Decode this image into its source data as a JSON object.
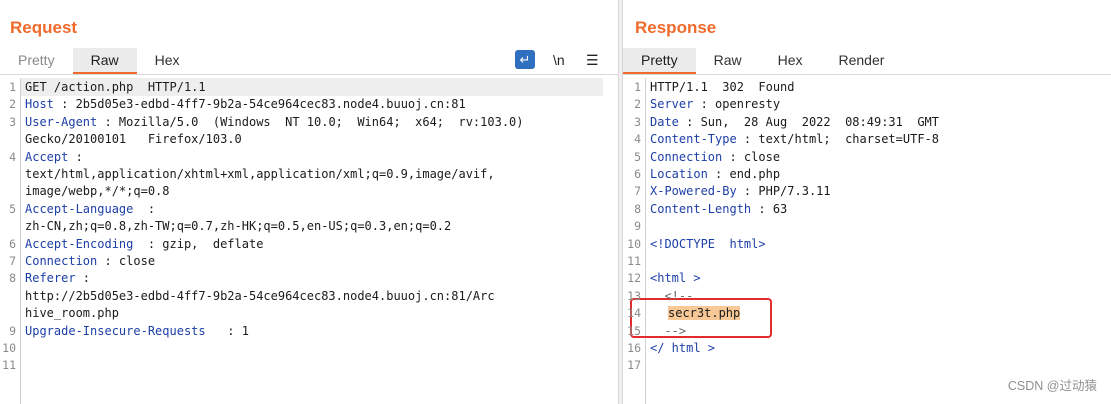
{
  "request": {
    "title": "Request",
    "tabs": [
      "Pretty",
      "Raw",
      "Hex"
    ],
    "tools": {
      "wrap_icon": "↵",
      "newline_toggle": "\\n",
      "menu": "☰"
    },
    "lines": [
      {
        "n": "1",
        "key": "",
        "text": "GET /action.php  HTTP/1.1"
      },
      {
        "n": "2",
        "key": "Host",
        "text": " : 2b5d05e3-edbd-4ff7-9b2a-54ce964cec83.node4.buuoj.cn:81"
      },
      {
        "n": "3",
        "key": "User-Agent",
        "text": " : Mozilla/5.0  (Windows  NT 10.0;  Win64;  x64;  rv:103.0)"
      },
      {
        "n": "",
        "key": "",
        "text": "Gecko/20100101   Firefox/103.0"
      },
      {
        "n": "4",
        "key": "Accept",
        "text": " :"
      },
      {
        "n": "",
        "key": "",
        "text": "text/html,application/xhtml+xml,application/xml;q=0.9,image/avif,"
      },
      {
        "n": "",
        "key": "",
        "text": "image/webp,*/*;q=0.8"
      },
      {
        "n": "5",
        "key": "Accept-Language",
        "text": "  :"
      },
      {
        "n": "",
        "key": "",
        "text": "zh-CN,zh;q=0.8,zh-TW;q=0.7,zh-HK;q=0.5,en-US;q=0.3,en;q=0.2"
      },
      {
        "n": "6",
        "key": "Accept-Encoding",
        "text": "  : gzip,  deflate"
      },
      {
        "n": "7",
        "key": "Connection",
        "text": " : close"
      },
      {
        "n": "8",
        "key": "Referer",
        "text": " :"
      },
      {
        "n": "",
        "key": "",
        "text": "http://2b5d05e3-edbd-4ff7-9b2a-54ce964cec83.node4.buuoj.cn:81/Arc"
      },
      {
        "n": "",
        "key": "",
        "text": "hive_room.php"
      },
      {
        "n": "9",
        "key": "Upgrade-Insecure-Requests",
        "text": "   : 1"
      },
      {
        "n": "10",
        "key": "",
        "text": ""
      },
      {
        "n": "11",
        "key": "",
        "text": ""
      }
    ]
  },
  "response": {
    "title": "Response",
    "tabs": [
      "Pretty",
      "Raw",
      "Hex",
      "Render"
    ],
    "lines": [
      {
        "n": "1",
        "key": "",
        "text": "HTTP/1.1  302  Found"
      },
      {
        "n": "2",
        "key": "Server",
        "text": " : openresty"
      },
      {
        "n": "3",
        "key": "Date",
        "text": " : Sun,  28 Aug  2022  08:49:31  GMT"
      },
      {
        "n": "4",
        "key": "Content-Type",
        "text": " : text/html;  charset=UTF-8"
      },
      {
        "n": "5",
        "key": "Connection",
        "text": " : close"
      },
      {
        "n": "6",
        "key": "Location",
        "text": " : end.php"
      },
      {
        "n": "7",
        "key": "X-Powered-By",
        "text": " : PHP/7.3.11"
      },
      {
        "n": "8",
        "key": "Content-Length",
        "text": " : 63"
      },
      {
        "n": "9",
        "key": "",
        "text": ""
      },
      {
        "n": "10",
        "key": "",
        "text": "<!DOCTYPE  html>"
      },
      {
        "n": "11",
        "key": "",
        "text": ""
      },
      {
        "n": "12",
        "key": "",
        "text": "<html >"
      },
      {
        "n": "13",
        "key": "",
        "text": "  <!--"
      },
      {
        "n": "14",
        "key": "",
        "text": "secr3t.php"
      },
      {
        "n": "15",
        "key": "",
        "text": "  -->"
      },
      {
        "n": "16",
        "key": "",
        "text": "</ html >"
      },
      {
        "n": "17",
        "key": "",
        "text": ""
      }
    ]
  },
  "watermark": "CSDN @过动猿",
  "colors": {
    "accent": "#f06a2c",
    "header_key": "#1d3fa8",
    "annotation_box": "#e22b2b",
    "found_highlight": "#f8c996"
  }
}
